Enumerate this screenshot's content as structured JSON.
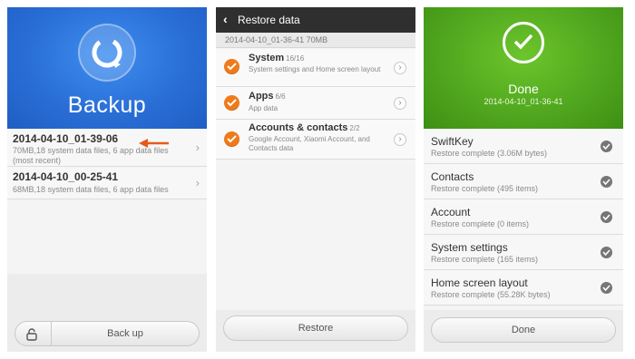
{
  "backup_screen": {
    "title": "Backup",
    "hero_icon": "backup-refresh-icon",
    "items": [
      {
        "name": "2014-04-10_01-39-06",
        "meta": "70MB,18  system data files, 6  app data files",
        "note": "(most recent)"
      },
      {
        "name": "2014-04-10_00-25-41",
        "meta": "68MB,18  system data files, 6  app data files"
      }
    ],
    "lock_icon": "unlock-icon",
    "backup_button": "Back up",
    "arrow_color": "#e85a1b"
  },
  "restore_screen": {
    "title": "Restore data",
    "subtitle": "2014-04-10_01-36-41   70MB",
    "items": [
      {
        "name": "System",
        "count": "16/16",
        "desc": "System settings and Home screen layout"
      },
      {
        "name": "Apps",
        "count": "6/6",
        "desc": "App data"
      },
      {
        "name": "Accounts & contacts",
        "count": "2/2",
        "desc": "Google Account, Xiaomi Account, and Contacts data"
      }
    ],
    "restore_button": "Restore",
    "check_color": "#f07a1a"
  },
  "done_screen": {
    "title": "Done",
    "subtitle": "2014-04-10_01-36-41",
    "items": [
      {
        "name": "SwiftKey",
        "status": "Restore complete (3.06M  bytes)"
      },
      {
        "name": "Contacts",
        "status": "Restore complete (495  items)"
      },
      {
        "name": "Account",
        "status": "Restore complete (0  items)"
      },
      {
        "name": "System settings",
        "status": "Restore complete (165  items)"
      },
      {
        "name": "Home screen layout",
        "status": "Restore complete (55.28K  bytes)"
      }
    ],
    "done_button": "Done",
    "accent_color": "#4fa51d"
  }
}
